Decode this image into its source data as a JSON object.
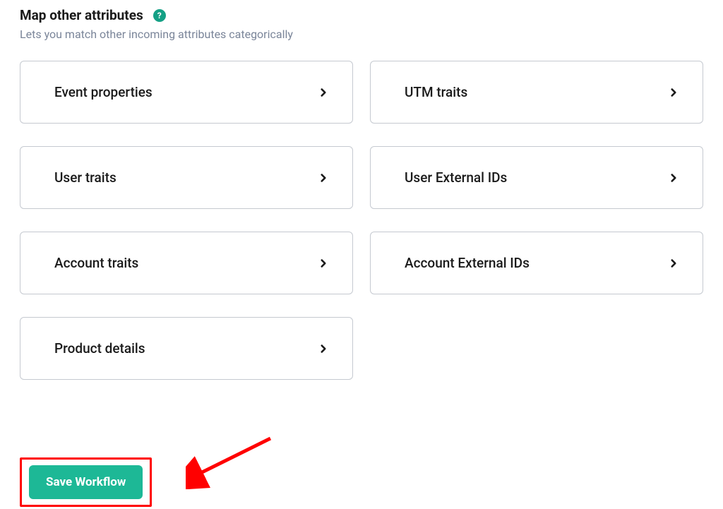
{
  "header": {
    "title": "Map other attributes",
    "help_tooltip": "?"
  },
  "subtitle": "Lets you match other incoming attributes categorically",
  "cards": [
    {
      "label": "Event properties",
      "name": "event-properties"
    },
    {
      "label": "UTM traits",
      "name": "utm-traits"
    },
    {
      "label": "User traits",
      "name": "user-traits"
    },
    {
      "label": "User External IDs",
      "name": "user-external-ids"
    },
    {
      "label": "Account traits",
      "name": "account-traits"
    },
    {
      "label": "Account External IDs",
      "name": "account-external-ids"
    },
    {
      "label": "Product details",
      "name": "product-details"
    }
  ],
  "footer": {
    "save_button": "Save Workflow"
  },
  "colors": {
    "accent": "#1db896",
    "highlight": "#ff0000"
  }
}
